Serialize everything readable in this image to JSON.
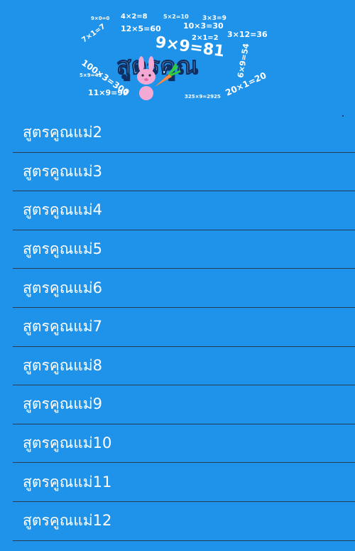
{
  "banner": {
    "title": "สูตรคูณ",
    "formula_main": "9×9=81",
    "formulas": [
      "4×2=8",
      "5×2=10",
      "3×3=9",
      "9×0=0",
      "12×5=60",
      "10×3=30",
      "2×1=2",
      "3×12=36",
      "100×3=300",
      "7×1=7",
      "5×9=45",
      "6×9=54",
      "11×9=99",
      "325×9=2925",
      "20×1=20"
    ]
  },
  "menu": {
    "items": [
      "สูตรคูณแม่2",
      "สูตรคูณแม่3",
      "สูตรคูณแม่4",
      "สูตรคูณแม่5",
      "สูตรคูณแม่6",
      "สูตรคูณแม่7",
      "สูตรคูณแม่8",
      "สูตรคูณแม่9",
      "สูตรคูณแม่10",
      "สูตรคูณแม่11",
      "สูตรคูณแม่12"
    ]
  },
  "colors": {
    "background": "#1f93ea",
    "text": "#ffffff",
    "divider": "#2a3b55",
    "title": "#e9f4ff",
    "bunny": "#f4a9d4",
    "carrot": "#ff8a3d",
    "leaf": "#2ecc40"
  },
  "icons": {
    "banner": "multiplication-banner-image",
    "mascot": "bunny-icon",
    "vegetable": "carrot-icon"
  }
}
